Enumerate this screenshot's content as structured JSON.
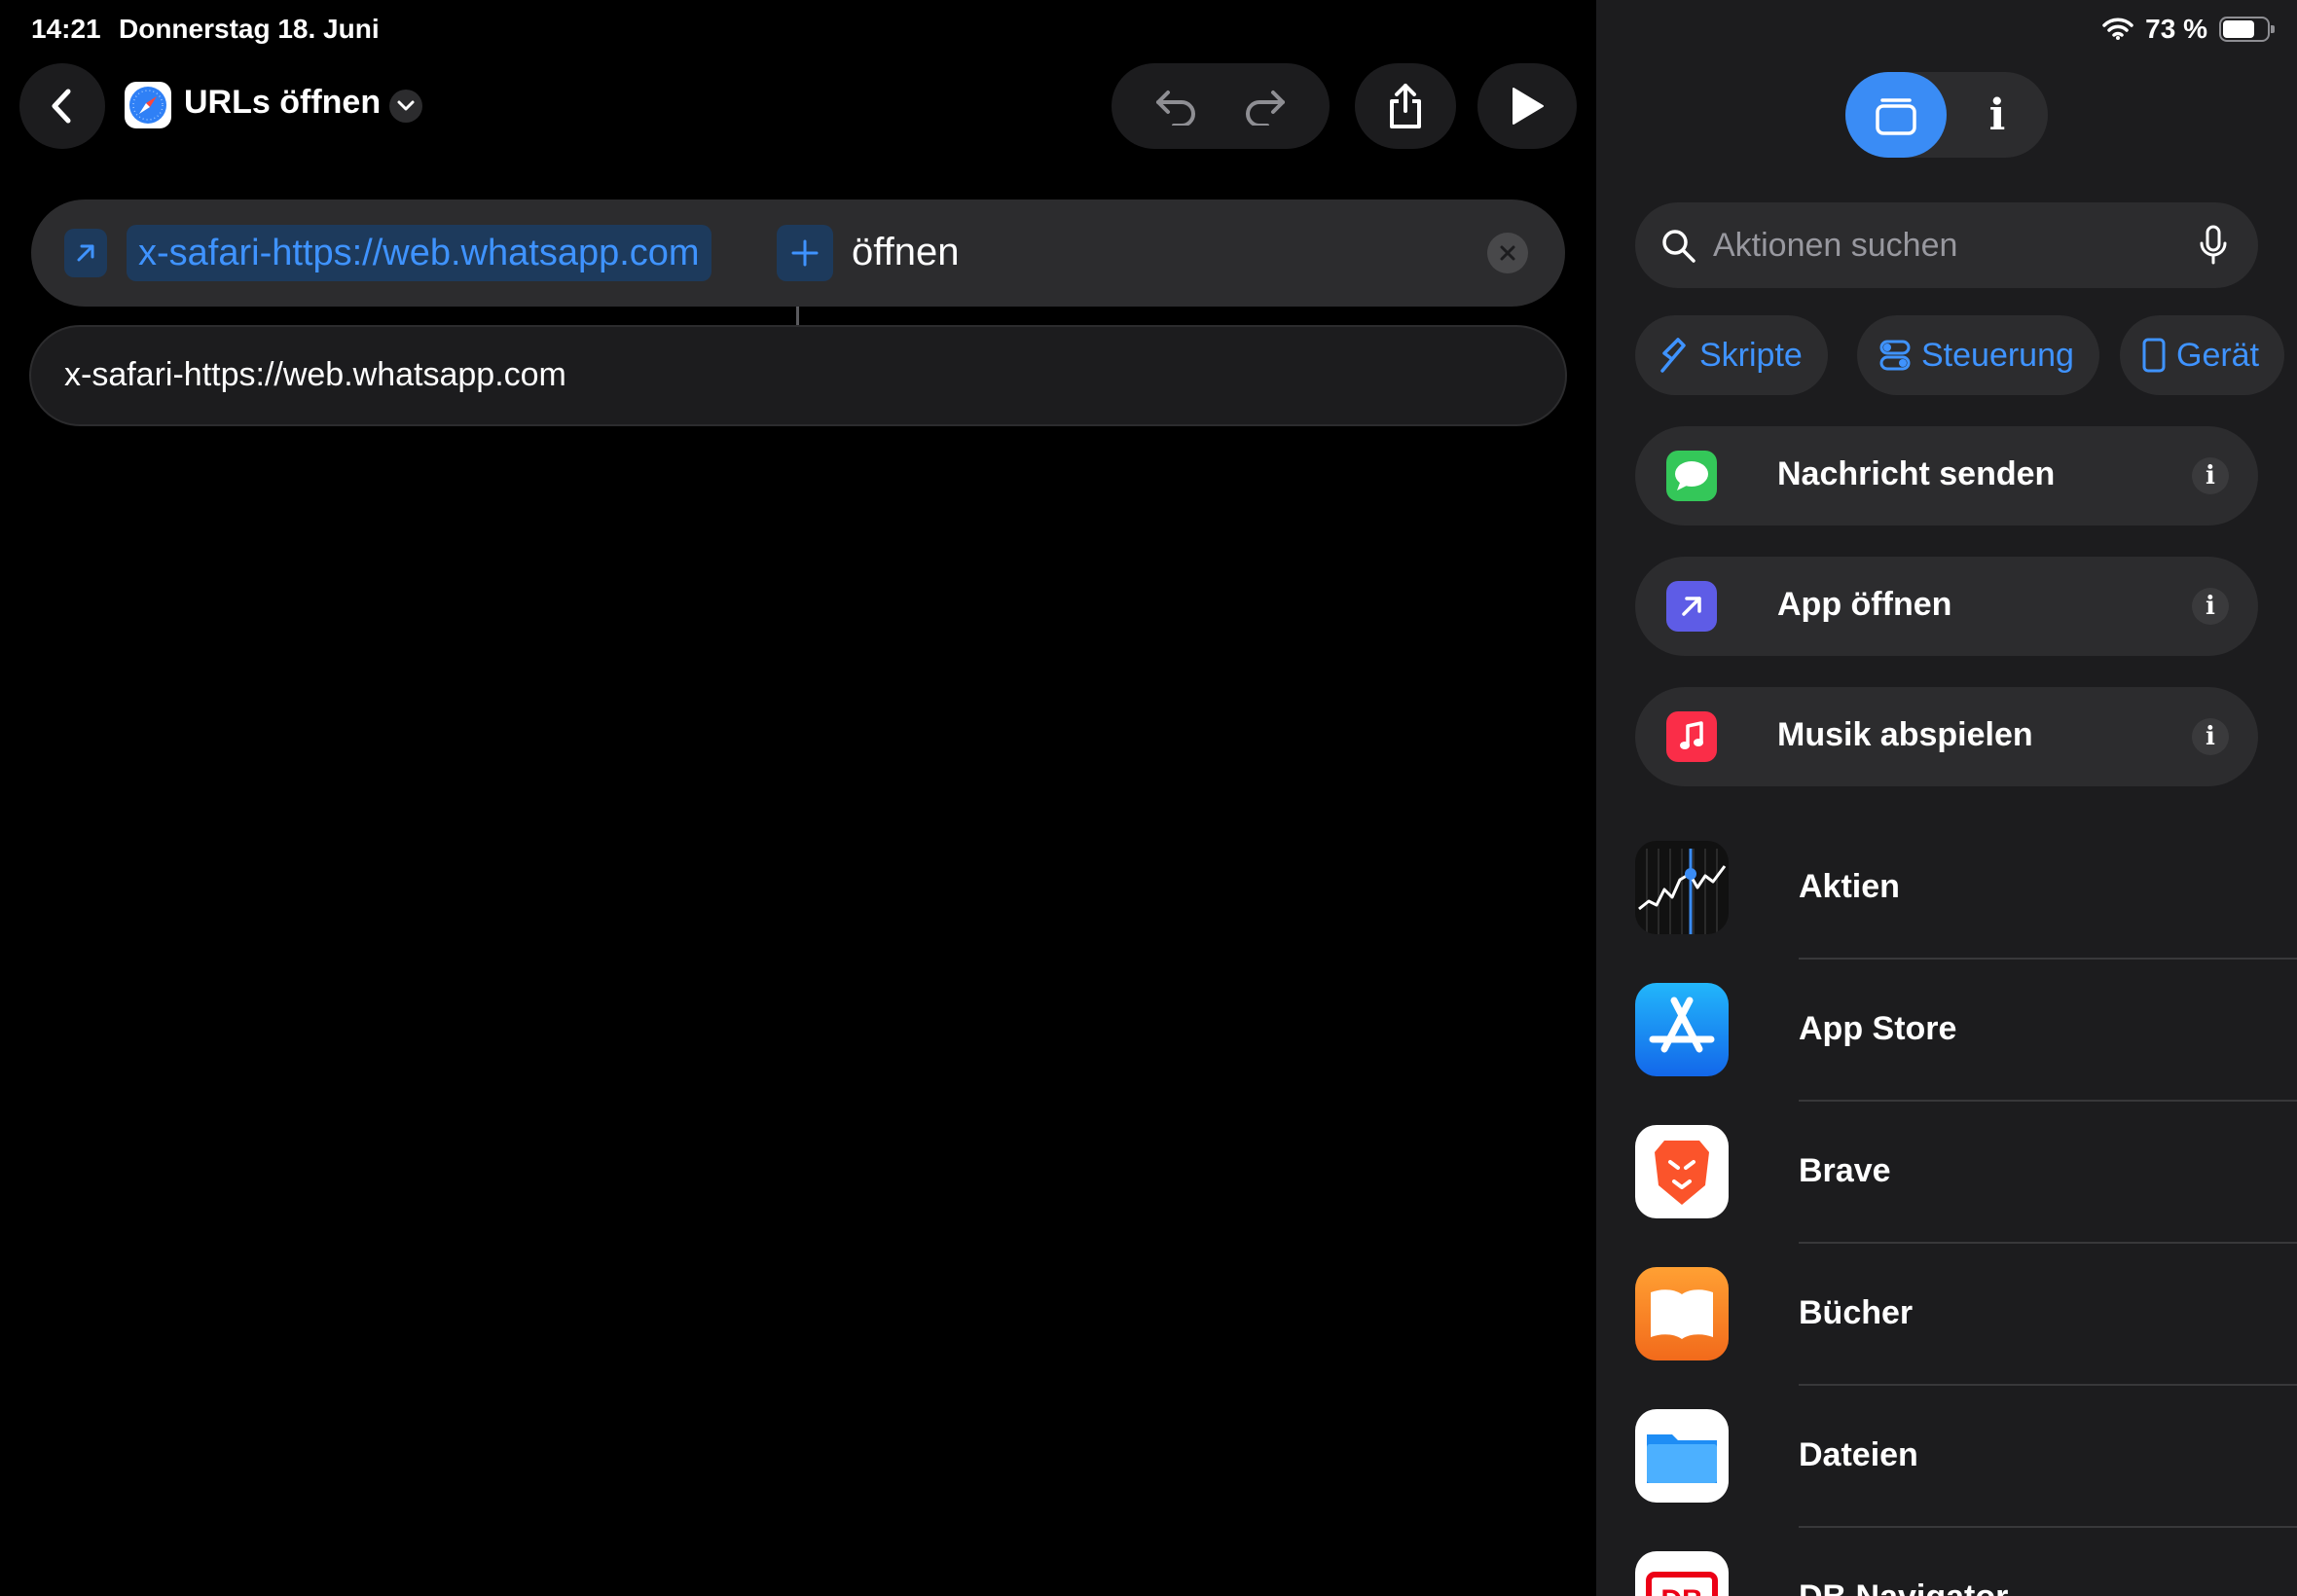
{
  "status": {
    "time": "14:21",
    "date": "Donnerstag 18. Juni",
    "battery": "73 %",
    "battery_level": 0.73
  },
  "header": {
    "title": "URLs öffnen",
    "title_icon": "safari-compass-icon"
  },
  "toolbar": {
    "back": "chevron-left-icon",
    "undo": "undo-icon",
    "redo": "redo-icon",
    "share": "share-icon",
    "run": "play-icon"
  },
  "action": {
    "url_token": "x-safari-https://web.whatsapp.com",
    "verb": "öffnen"
  },
  "url_field": {
    "value": "x-safari-https://web.whatsapp.com"
  },
  "sidebar": {
    "search_placeholder": "Aktionen suchen",
    "categories": [
      {
        "label": "Skripte",
        "icon": "scripts-icon"
      },
      {
        "label": "Steuerung",
        "icon": "toggles-icon"
      },
      {
        "label": "Gerät",
        "icon": "ipad-icon"
      }
    ],
    "suggestions": [
      {
        "label": "Nachricht senden",
        "icon": "messages-icon",
        "color": "#34c759"
      },
      {
        "label": "App öffnen",
        "icon": "open-app-icon",
        "color": "#5e5ce6"
      },
      {
        "label": "Musik abspielen",
        "icon": "music-icon",
        "color": "#fa2d48"
      }
    ],
    "apps": [
      {
        "label": "Aktien",
        "icon": "stocks-icon"
      },
      {
        "label": "App Store",
        "icon": "app-store-icon"
      },
      {
        "label": "Brave",
        "icon": "brave-icon"
      },
      {
        "label": "Bücher",
        "icon": "books-icon"
      },
      {
        "label": "Dateien",
        "icon": "files-icon"
      },
      {
        "label": "DB Navigator",
        "icon": "db-navigator-icon"
      }
    ]
  },
  "colors": {
    "accent": "#3f93ff",
    "segment_active": "#3a8cf5",
    "panel": "#1c1c1e"
  }
}
